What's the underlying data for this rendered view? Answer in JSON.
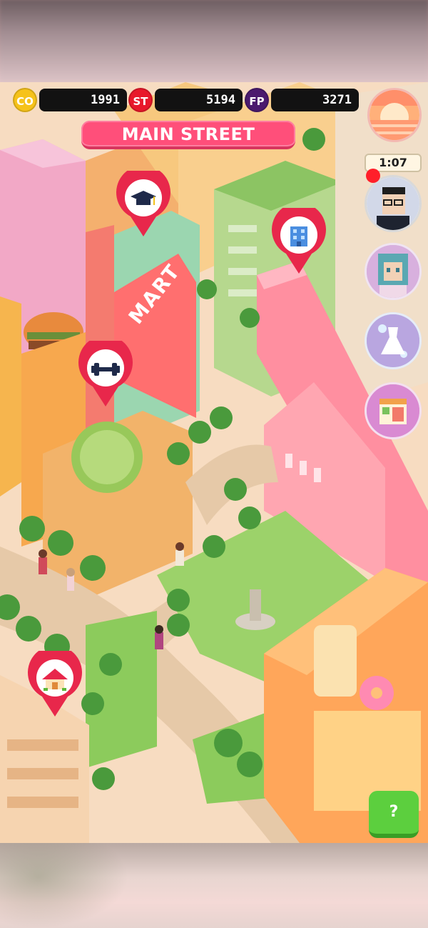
{
  "resources": [
    {
      "code": "CO",
      "value": "1991",
      "color": "#f6c21a"
    },
    {
      "code": "ST",
      "value": "5194",
      "color": "#e8182a"
    },
    {
      "code": "FP",
      "value": "3271",
      "color": "#4b1a6e"
    }
  ],
  "location_title": "MAIN STREET",
  "timer": "1:07",
  "help_label": "?",
  "map_signs": {
    "mart": "MART"
  },
  "pins": [
    {
      "name": "school-pin",
      "icon": "graduation-cap-icon"
    },
    {
      "name": "office-pin",
      "icon": "office-building-icon"
    },
    {
      "name": "gym-pin",
      "icon": "dumbbell-icon"
    },
    {
      "name": "home-pin",
      "icon": "house-icon"
    }
  ],
  "side_buttons": [
    {
      "name": "avatar-player-button",
      "icon": "boy-avatar-icon"
    },
    {
      "name": "avatar-npc-button",
      "icon": "girl-avatar-icon"
    },
    {
      "name": "wardrobe-button",
      "icon": "dress-icon"
    },
    {
      "name": "shop-button",
      "icon": "shop-icon"
    }
  ],
  "colors": {
    "accent_pink": "#ff4f7a",
    "pin_red": "#e8274b",
    "help_green": "#5ccf3e"
  }
}
